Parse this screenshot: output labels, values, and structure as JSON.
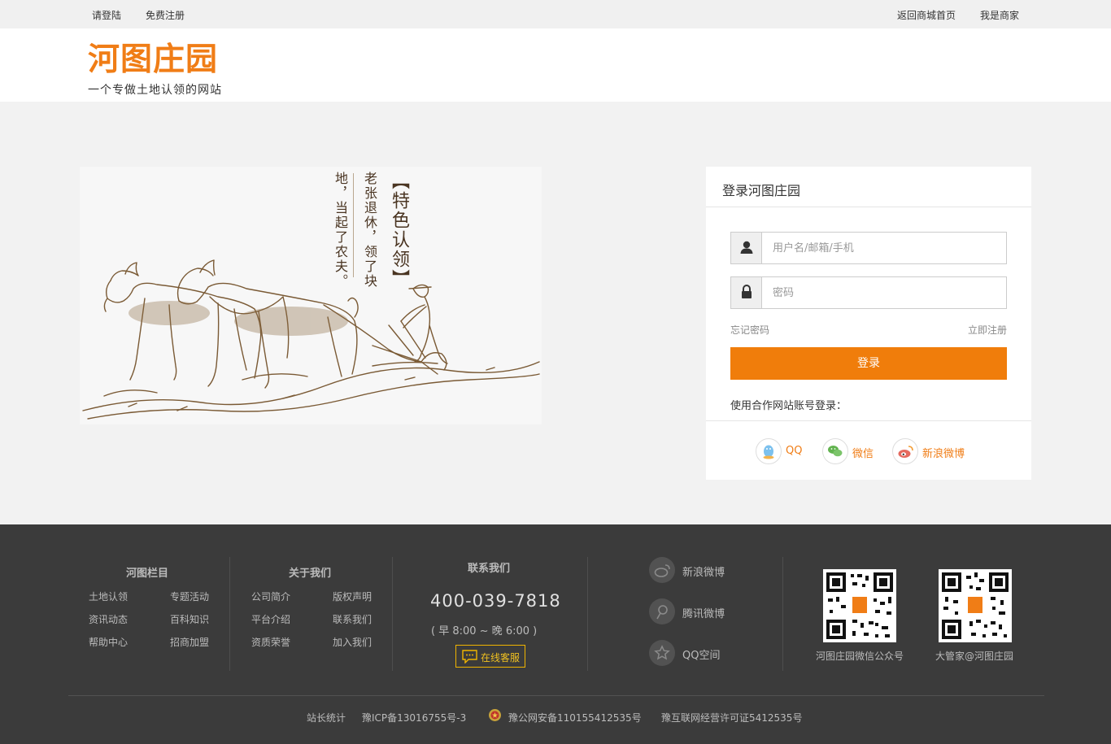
{
  "topbar": {
    "login": "请登陆",
    "register": "免费注册",
    "back_home": "返回商城首页",
    "merchant": "我是商家"
  },
  "brand": {
    "name": "河图庄园",
    "slogan": "一个专做土地认领的网站",
    "accent_color": "#f07d16"
  },
  "promo": {
    "title": "【特色认领】",
    "line1": "老张退休，领了块",
    "line2": "地，当起了农夫。"
  },
  "login": {
    "title": "登录河图庄园",
    "username_placeholder": "用户名/邮箱/手机",
    "password_placeholder": "密码",
    "username_icon": "user-icon",
    "password_icon": "lock-icon",
    "forgot": "忘记密码",
    "register_now": "立即注册",
    "submit": "登录",
    "partner_label": "使用合作网站账号登录：",
    "partners": [
      {
        "label": "QQ",
        "icon": "qq-icon",
        "color": "#5fb0e8"
      },
      {
        "label": "微信",
        "icon": "wechat-icon",
        "color": "#5cb85c"
      },
      {
        "label": "新浪微博",
        "icon": "weibo-icon",
        "color": "#e5635b"
      }
    ]
  },
  "footer": {
    "col1": {
      "title": "河图栏目",
      "links": [
        "土地认领",
        "专题活动",
        "资讯动态",
        "百科知识",
        "帮助中心",
        "招商加盟"
      ]
    },
    "col2": {
      "title": "关于我们",
      "links": [
        "公司简介",
        "版权声明",
        "平台介绍",
        "联系我们",
        "资质荣誉",
        "加入我们"
      ]
    },
    "contact": {
      "title": "联系我们",
      "phone": "400-039-7818",
      "hours": "( 早 8:00 ~ 晚 6:00 )",
      "service_button": "在线客服",
      "service_icon": "chat-icon"
    },
    "social": [
      {
        "label": "新浪微博",
        "icon": "weibo-icon"
      },
      {
        "label": "腾讯微博",
        "icon": "tencent-weibo-icon"
      },
      {
        "label": "QQ空间",
        "icon": "qzone-icon"
      }
    ],
    "qrcodes": [
      {
        "caption": "河图庄园微信公众号"
      },
      {
        "caption": "大管家@河图庄园"
      }
    ],
    "bottom": {
      "stats": "站长统计",
      "icp": "豫ICP备13016755号-3",
      "police": "豫公网安备110155412535号",
      "license": "豫互联网经营许可证5412535号"
    }
  }
}
